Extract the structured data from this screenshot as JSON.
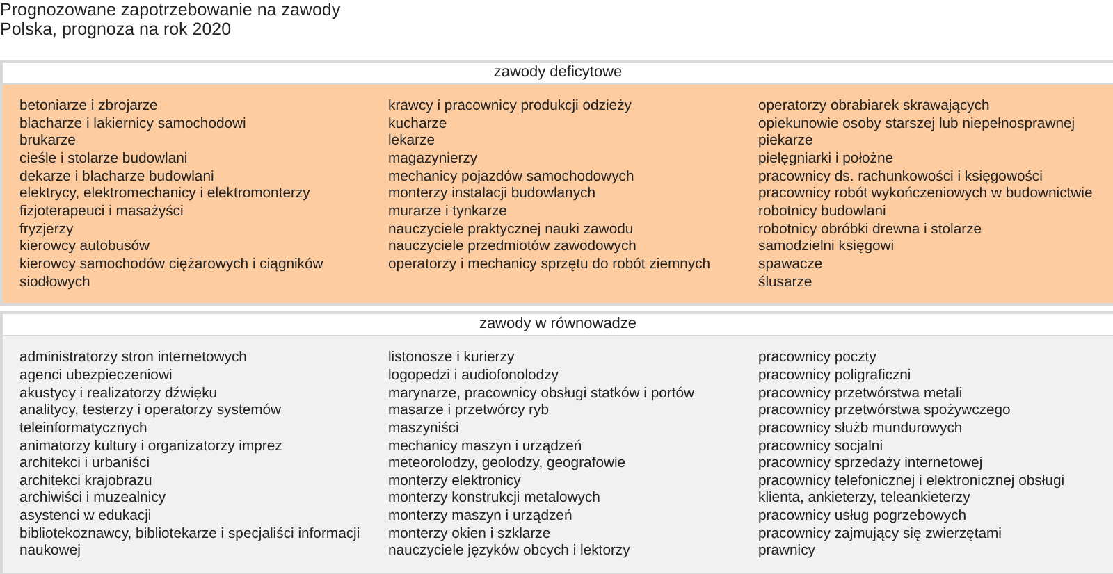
{
  "title": "Prognozowane zapotrzebowanie na zawody",
  "subtitle": "Polska, prognoza na rok 2020",
  "sections": [
    {
      "kind": "deficit",
      "heading": "zawody deficytowe",
      "columns": [
        [
          "betoniarze i zbrojarze",
          "blacharze i lakiernicy samochodowi",
          "brukarze",
          "cieśle i stolarze budowlani",
          "dekarze i blacharze budowlani",
          "elektrycy, elektromechanicy i elektromonterzy",
          "fizjoterapeuci i masażyści",
          "fryzjerzy",
          "kierowcy autobusów",
          "kierowcy samochodów ciężarowych i ciągników siodłowych"
        ],
        [
          "krawcy i pracownicy produkcji odzieży",
          "kucharze",
          "lekarze",
          "magazynierzy",
          "mechanicy pojazdów samochodowych",
          "monterzy instalacji budowlanych",
          "murarze i tynkarze",
          "nauczyciele praktycznej nauki zawodu",
          "nauczyciele przedmiotów zawodowych",
          "operatorzy i mechanicy sprzętu do robót ziemnych"
        ],
        [
          "operatorzy obrabiarek skrawających",
          "opiekunowie osoby starszej lub niepełnosprawnej",
          "piekarze",
          "pielęgniarki i położne",
          "pracownicy ds. rachunkowości i księgowości",
          "pracownicy robót wykończeniowych w budownictwie",
          "robotnicy budowlani",
          "robotnicy obróbki drewna i stolarze",
          "samodzielni księgowi",
          "spawacze",
          "ślusarze"
        ]
      ]
    },
    {
      "kind": "balance",
      "heading": "zawody w równowadze",
      "columns": [
        [
          "administratorzy stron internetowych",
          "agenci ubezpieczeniowi",
          "akustycy i realizatorzy dźwięku",
          "analitycy, testerzy i operatorzy systemów teleinformatycznych",
          "animatorzy kultury i organizatorzy imprez",
          "architekci i urbaniści",
          "architekci krajobrazu",
          "archiwiści i muzealnicy",
          "asystenci w edukacji",
          "bibliotekoznawcy, bibliotekarze i specjaliści informacji naukowej"
        ],
        [
          "listonosze i kurierzy",
          "logopedzi i audiofonolodzy",
          "marynarze, pracownicy obsługi statków i portów",
          "masarze i przetwórcy ryb",
          "maszyniści",
          "mechanicy maszyn i urządzeń",
          "meteorolodzy, geolodzy, geografowie",
          "monterzy elektronicy",
          "monterzy konstrukcji metalowych",
          "monterzy maszyn i urządzeń",
          "monterzy okien i szklarze",
          "nauczyciele języków obcych i lektorzy"
        ],
        [
          "pracownicy poczty",
          "pracownicy poligraficzni",
          "pracownicy przetwórstwa metali",
          "pracownicy przetwórstwa spożywczego",
          "pracownicy służb mundurowych",
          "pracownicy socjalni",
          "pracownicy sprzedaży internetowej",
          "pracownicy telefonicznej i elektronicznej obsługi klienta, ankieterzy, teleankieterzy",
          "pracownicy usług pogrzebowych",
          "pracownicy zajmujący się zwierzętami",
          "prawnicy"
        ]
      ]
    }
  ]
}
